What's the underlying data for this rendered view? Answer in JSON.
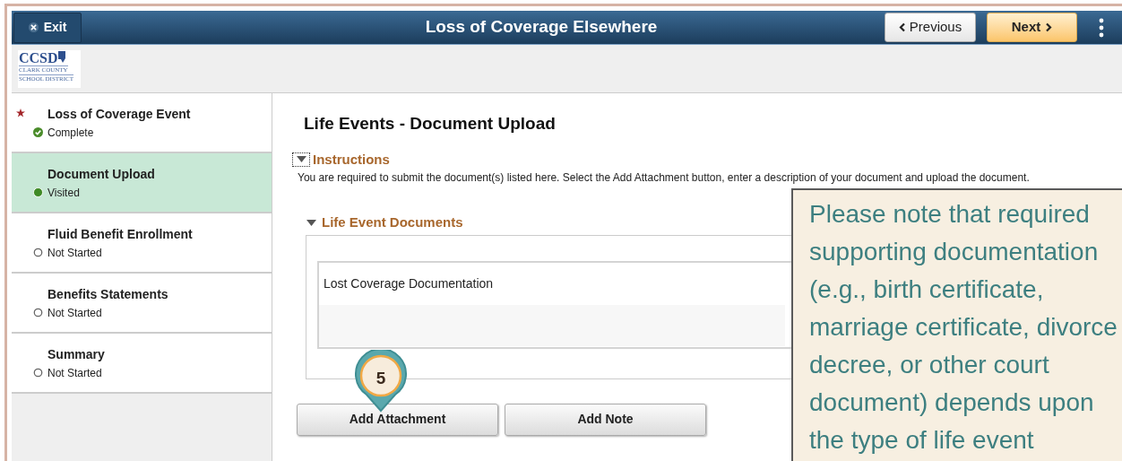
{
  "header": {
    "exit": "Exit",
    "title": "Loss of Coverage Elsewhere",
    "previous": "Previous",
    "next": "Next"
  },
  "logo": {
    "abbr": "CCSD",
    "line1": "CLARK COUNTY",
    "line2": "SCHOOL DISTRICT"
  },
  "steps": [
    {
      "label": "Loss of Coverage Event",
      "status": "Complete",
      "kind": "complete",
      "required": true,
      "selected": false
    },
    {
      "label": "Document Upload",
      "status": "Visited",
      "kind": "visited",
      "required": false,
      "selected": true
    },
    {
      "label": "Fluid Benefit Enrollment",
      "status": "Not Started",
      "kind": "not_started",
      "required": false,
      "selected": false
    },
    {
      "label": "Benefits Statements",
      "status": "Not Started",
      "kind": "not_started",
      "required": false,
      "selected": false
    },
    {
      "label": "Summary",
      "status": "Not Started",
      "kind": "not_started",
      "required": false,
      "selected": false
    }
  ],
  "page_title": "Life Events - Document Upload",
  "instructions": {
    "label": "Instructions",
    "expanded": true,
    "text": "You are required to submit the document(s) listed here. Select the Add Attachment button, enter a description of your document and upload the document."
  },
  "documents": {
    "label": "Life Event Documents",
    "expanded": true,
    "rows": [
      "Lost Coverage Documentation"
    ]
  },
  "buttons": [
    "Add Attachment",
    "Add Note"
  ],
  "callout": {
    "number": "5",
    "note": "Please note that required supporting documentation (e.g., birth certificate, marriage certificate, divorce decree, or other court document) depends upon the type of life event"
  }
}
